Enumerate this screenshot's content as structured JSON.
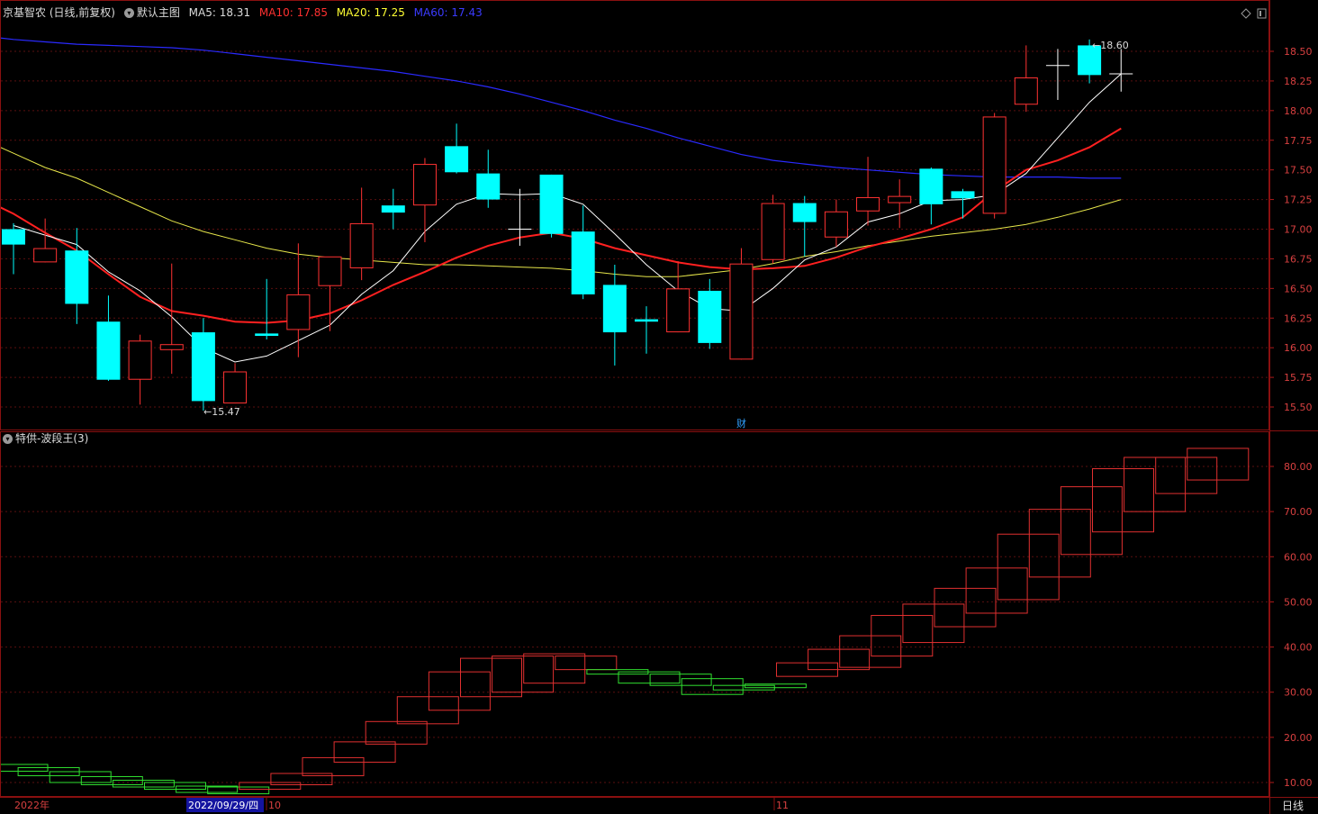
{
  "main_header": {
    "stock": "京基智农 (日线,前复权)",
    "template": "默认主图",
    "ma5": "MA5: 18.31",
    "ma10": "MA10: 17.85",
    "ma20": "MA20: 17.25",
    "ma60": "MA60: 17.43"
  },
  "sub_header": {
    "indicator": "特供-波段王(3)"
  },
  "main_annotations": {
    "high_label": "18.60",
    "low_label": "15.47",
    "fin_marker": "财"
  },
  "main_axis": {
    "ticks": [
      "18.50",
      "18.25",
      "18.00",
      "17.75",
      "17.50",
      "17.25",
      "17.00",
      "16.75",
      "16.50",
      "16.25",
      "16.00",
      "15.75",
      "15.50"
    ]
  },
  "sub_axis": {
    "ticks": [
      "80.00",
      "70.00",
      "60.00",
      "50.00",
      "40.00",
      "30.00",
      "20.00",
      "10.00"
    ]
  },
  "time_axis": {
    "year": "2022年",
    "cursor_date": "2022/09/29/四",
    "month_oct": "10",
    "month_nov": "11",
    "period": "日线"
  },
  "colors": {
    "up": "#ff3232",
    "down": "#00ffff",
    "ma5": "#ffffff",
    "ma10": "#ff2020",
    "ma20": "#e6e64a",
    "ma60": "#2a2aff",
    "wave_up": "#e03030",
    "wave_down": "#30e030"
  },
  "chart_data": {
    "type": "candlestick",
    "main": {
      "candles": [
        {
          "o": 17.0,
          "h": 17.05,
          "l": 16.62,
          "c": 16.87
        },
        {
          "o": 16.72,
          "h": 17.09,
          "l": 16.72,
          "c": 16.84
        },
        {
          "o": 16.82,
          "h": 17.01,
          "l": 16.2,
          "c": 16.37
        },
        {
          "o": 16.22,
          "h": 16.44,
          "l": 15.72,
          "c": 15.73
        },
        {
          "o": 15.73,
          "h": 16.11,
          "l": 15.52,
          "c": 16.06
        },
        {
          "o": 15.98,
          "h": 16.71,
          "l": 15.78,
          "c": 16.03
        },
        {
          "o": 16.13,
          "h": 16.25,
          "l": 15.47,
          "c": 15.55
        },
        {
          "o": 15.53,
          "h": 15.87,
          "l": 15.53,
          "c": 15.8
        },
        {
          "o": 16.12,
          "h": 16.58,
          "l": 16.07,
          "c": 16.1
        },
        {
          "o": 16.15,
          "h": 16.88,
          "l": 15.92,
          "c": 16.45
        },
        {
          "o": 16.52,
          "h": 16.76,
          "l": 16.14,
          "c": 16.77
        },
        {
          "o": 16.67,
          "h": 17.35,
          "l": 16.57,
          "c": 17.05
        },
        {
          "o": 17.2,
          "h": 17.34,
          "l": 17.0,
          "c": 17.14
        },
        {
          "o": 17.2,
          "h": 17.6,
          "l": 16.89,
          "c": 17.55
        },
        {
          "o": 17.7,
          "h": 17.89,
          "l": 17.47,
          "c": 17.48
        },
        {
          "o": 17.47,
          "h": 17.67,
          "l": 17.18,
          "c": 17.25
        },
        {
          "o": 17.0,
          "h": 17.34,
          "l": 16.86,
          "c": 17.0
        },
        {
          "o": 17.46,
          "h": 17.46,
          "l": 16.93,
          "c": 16.96
        },
        {
          "o": 16.98,
          "h": 17.2,
          "l": 16.41,
          "c": 16.45
        },
        {
          "o": 16.53,
          "h": 16.7,
          "l": 15.85,
          "c": 16.13
        },
        {
          "o": 16.24,
          "h": 16.35,
          "l": 15.95,
          "c": 16.22
        },
        {
          "o": 16.13,
          "h": 16.73,
          "l": 16.13,
          "c": 16.5
        },
        {
          "o": 16.48,
          "h": 16.58,
          "l": 15.99,
          "c": 16.04
        },
        {
          "o": 15.9,
          "h": 16.84,
          "l": 15.9,
          "c": 16.71
        },
        {
          "o": 16.74,
          "h": 17.29,
          "l": 16.71,
          "c": 17.22
        },
        {
          "o": 17.22,
          "h": 17.28,
          "l": 16.77,
          "c": 17.06
        },
        {
          "o": 16.93,
          "h": 17.25,
          "l": 16.85,
          "c": 17.15
        },
        {
          "o": 17.15,
          "h": 17.61,
          "l": 17.03,
          "c": 17.27
        },
        {
          "o": 17.22,
          "h": 17.42,
          "l": 17.01,
          "c": 17.28
        },
        {
          "o": 17.51,
          "h": 17.52,
          "l": 17.04,
          "c": 17.21
        },
        {
          "o": 17.32,
          "h": 17.34,
          "l": 17.09,
          "c": 17.26
        },
        {
          "o": 17.13,
          "h": 17.98,
          "l": 17.09,
          "c": 17.95
        },
        {
          "o": 18.05,
          "h": 18.55,
          "l": 17.99,
          "c": 18.28
        },
        {
          "o": 18.38,
          "h": 18.52,
          "l": 18.09,
          "c": 18.38
        },
        {
          "o": 18.55,
          "h": 18.6,
          "l": 18.23,
          "c": 18.3
        },
        {
          "o": 18.31,
          "h": 18.52,
          "l": 18.16,
          "c": 18.31
        }
      ],
      "ma5": [
        17.03,
        16.95,
        16.87,
        16.64,
        16.48,
        16.26,
        16.0,
        15.88,
        15.93,
        16.06,
        16.19,
        16.45,
        16.65,
        16.98,
        17.21,
        17.3,
        17.29,
        17.3,
        17.21,
        16.96,
        16.7,
        16.48,
        16.33,
        16.31,
        16.5,
        16.74,
        16.85,
        17.06,
        17.13,
        17.24,
        17.25,
        17.29,
        17.47,
        17.77,
        18.07,
        18.31
      ],
      "ma10": [
        17.5,
        17.38,
        17.26,
        17.13,
        16.97,
        16.82,
        16.62,
        16.43,
        16.31,
        16.27,
        16.22,
        16.21,
        16.23,
        16.29,
        16.4,
        16.53,
        16.64,
        16.76,
        16.86,
        16.93,
        16.97,
        16.92,
        16.84,
        16.78,
        16.72,
        16.68,
        16.66,
        16.67,
        16.69,
        16.76,
        16.85,
        16.92,
        17.0,
        17.1,
        17.32,
        17.5,
        17.58,
        17.69,
        17.85
      ],
      "ma20": [
        17.93,
        17.84,
        17.76,
        17.64,
        17.52,
        17.43,
        17.31,
        17.19,
        17.07,
        16.98,
        16.91,
        16.84,
        16.79,
        16.76,
        16.74,
        16.72,
        16.7,
        16.7,
        16.69,
        16.68,
        16.67,
        16.65,
        16.62,
        16.6,
        16.6,
        16.63,
        16.66,
        16.71,
        16.77,
        16.81,
        16.86,
        16.9,
        16.94,
        16.97,
        17.0,
        17.04,
        17.1,
        17.17,
        17.25
      ],
      "ma60": [
        18.69,
        18.66,
        18.63,
        18.6,
        18.58,
        18.56,
        18.55,
        18.54,
        18.53,
        18.51,
        18.48,
        18.45,
        18.42,
        18.39,
        18.36,
        18.33,
        18.29,
        18.25,
        18.2,
        18.14,
        18.07,
        18.0,
        17.92,
        17.85,
        17.77,
        17.7,
        17.63,
        17.58,
        17.55,
        17.52,
        17.5,
        17.48,
        17.46,
        17.45,
        17.44,
        17.44,
        17.44,
        17.43,
        17.43
      ],
      "y_range": [
        15.4,
        18.8
      ]
    },
    "wave": {
      "bricks": [
        {
          "lo": 12.5,
          "hi": 14.0,
          "up": false
        },
        {
          "lo": 11.5,
          "hi": 13.3,
          "up": false
        },
        {
          "lo": 10.0,
          "hi": 12.4,
          "up": false
        },
        {
          "lo": 9.5,
          "hi": 11.3,
          "up": false
        },
        {
          "lo": 9.0,
          "hi": 10.5,
          "up": false
        },
        {
          "lo": 8.5,
          "hi": 10.0,
          "up": false
        },
        {
          "lo": 7.8,
          "hi": 9.2,
          "up": false
        },
        {
          "lo": 7.5,
          "hi": 9.0,
          "up": false
        },
        {
          "lo": 8.5,
          "hi": 10.0,
          "up": true
        },
        {
          "lo": 9.5,
          "hi": 12.0,
          "up": true
        },
        {
          "lo": 11.5,
          "hi": 15.5,
          "up": true
        },
        {
          "lo": 14.5,
          "hi": 19.0,
          "up": true
        },
        {
          "lo": 18.5,
          "hi": 23.5,
          "up": true
        },
        {
          "lo": 23.0,
          "hi": 29.0,
          "up": true
        },
        {
          "lo": 26.0,
          "hi": 34.5,
          "up": true
        },
        {
          "lo": 29.0,
          "hi": 37.5,
          "up": true
        },
        {
          "lo": 30.0,
          "hi": 38.0,
          "up": true
        },
        {
          "lo": 32.0,
          "hi": 38.5,
          "up": true
        },
        {
          "lo": 35.0,
          "hi": 38.0,
          "up": true
        },
        {
          "lo": 34.0,
          "hi": 35.0,
          "up": false
        },
        {
          "lo": 32.0,
          "hi": 34.5,
          "up": false
        },
        {
          "lo": 31.5,
          "hi": 34.0,
          "up": false
        },
        {
          "lo": 29.5,
          "hi": 33.0,
          "up": false
        },
        {
          "lo": 30.5,
          "hi": 31.5,
          "up": false
        },
        {
          "lo": 31.0,
          "hi": 31.8,
          "up": false
        },
        {
          "lo": 33.5,
          "hi": 36.5,
          "up": true
        },
        {
          "lo": 35.0,
          "hi": 39.5,
          "up": true
        },
        {
          "lo": 35.5,
          "hi": 42.5,
          "up": true
        },
        {
          "lo": 38.0,
          "hi": 47.0,
          "up": true
        },
        {
          "lo": 41.0,
          "hi": 49.5,
          "up": true
        },
        {
          "lo": 44.5,
          "hi": 53.0,
          "up": true
        },
        {
          "lo": 47.5,
          "hi": 57.5,
          "up": true
        },
        {
          "lo": 50.5,
          "hi": 65.0,
          "up": true
        },
        {
          "lo": 55.5,
          "hi": 70.5,
          "up": true
        },
        {
          "lo": 60.5,
          "hi": 75.5,
          "up": true
        },
        {
          "lo": 65.5,
          "hi": 79.5,
          "up": true
        },
        {
          "lo": 70.0,
          "hi": 82.0,
          "up": true
        },
        {
          "lo": 74.0,
          "hi": 82.0,
          "up": true
        },
        {
          "lo": 77.0,
          "hi": 84.0,
          "up": true
        }
      ],
      "y_range": [
        5,
        88
      ]
    }
  }
}
